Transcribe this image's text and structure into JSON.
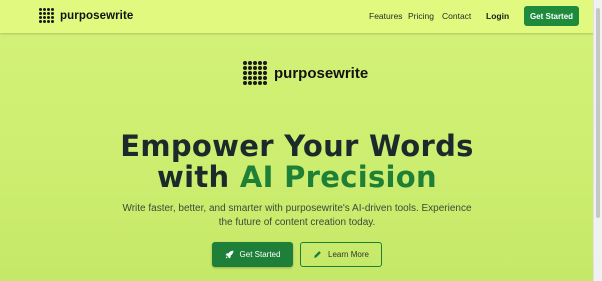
{
  "nav": {
    "brand": "purposewrite",
    "links": [
      "Features",
      "Pricing",
      "Contact"
    ],
    "login": "Login",
    "cta": "Get Started"
  },
  "hero": {
    "brand": "purposewrite",
    "headline_line1": "Empower Your Words",
    "headline_line2_prefix": "with ",
    "headline_line2_accent": "AI Precision",
    "subtitle": "Write faster, better, and smarter with purposewrite's AI-driven tools. Experience the future of content creation today.",
    "primary_button": "Get Started",
    "secondary_button": "Learn More"
  },
  "icons": {
    "logo": "dot-grid-logo-icon",
    "primary": "rocket-icon",
    "secondary": "pen-icon"
  },
  "colors": {
    "accent_green": "#1d7f38",
    "background": "#cdee70",
    "navbar": "#e2f97f"
  }
}
